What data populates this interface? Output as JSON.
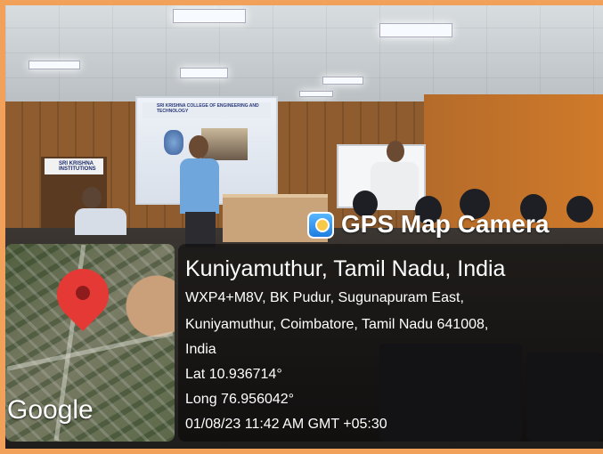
{
  "overlay": {
    "app_name": "GPS Map Camera",
    "location_title": "Kuniyamuthur, Tamil Nadu, India",
    "address_line1": "WXP4+M8V, BK Pudur, Sugunapuram East,",
    "address_line2": "Kuniyamuthur, Coimbatore, Tamil Nadu 641008,",
    "address_line3": "India",
    "latitude": "Lat 10.936714°",
    "longitude": "Long 76.956042°",
    "datetime": "01/08/23 11:42 AM GMT +05:30",
    "map_brand": "Google"
  },
  "scene": {
    "podium_sign": "SRI KRISHNA INSTITUTIONS",
    "screen_title": "SRI KRISHNA COLLEGE OF ENGINEERING AND TECHNOLOGY"
  },
  "colors": {
    "frame": "#f2a15a",
    "pin": "#e53935",
    "overlay_text": "#ffffff"
  },
  "icons": [
    "gps-map-camera-logo-icon",
    "map-pin-icon"
  ]
}
